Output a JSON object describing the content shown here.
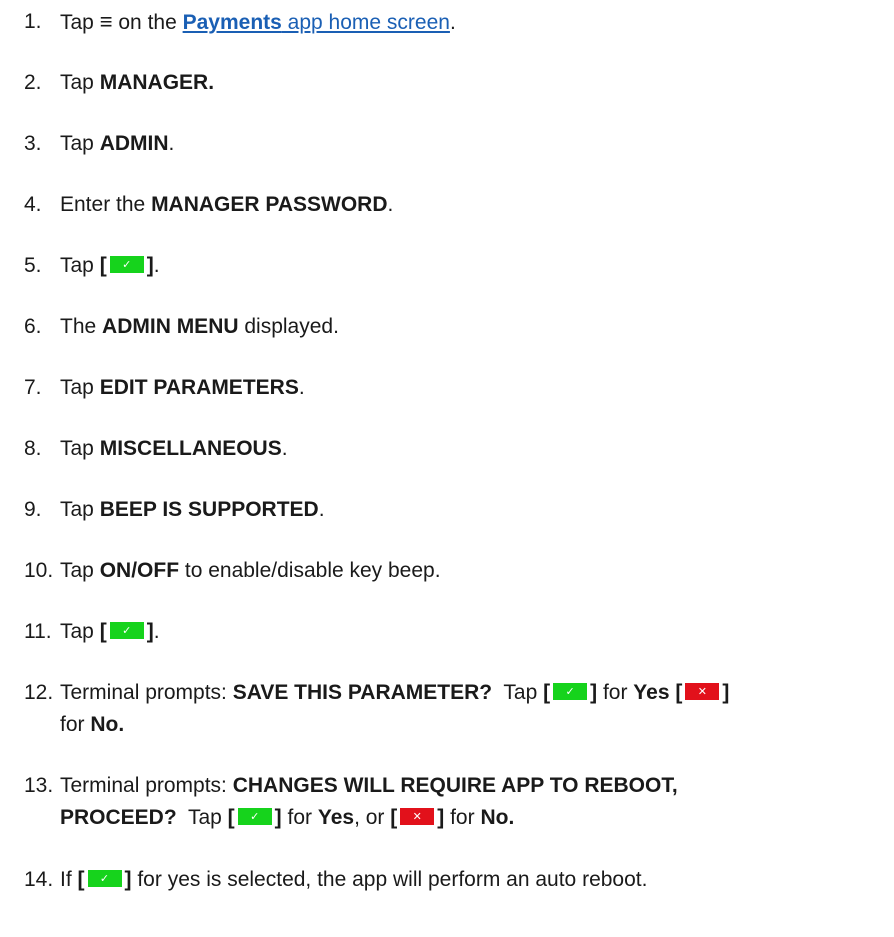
{
  "steps": [
    {
      "num": "1.",
      "parts": {
        "a": "Tap ",
        "icon": "≡",
        "b": " on the ",
        "link_bold": "Payments",
        "link_rest": " app home screen",
        "c": "."
      }
    },
    {
      "num": "2.",
      "parts": {
        "a": "Tap ",
        "b1": "MANAGER."
      }
    },
    {
      "num": "3.",
      "parts": {
        "a": "Tap ",
        "b1": "ADMIN",
        "c": "."
      }
    },
    {
      "num": "4.",
      "parts": {
        "a": "Enter the ",
        "b1": "MANAGER PASSWORD",
        "c": "."
      }
    },
    {
      "num": "5.",
      "parts": {
        "a": "Tap ",
        "open": "[",
        "close": "]",
        "c": "."
      }
    },
    {
      "num": "6.",
      "parts": {
        "a": "The ",
        "b1": "ADMIN MENU",
        "c": " displayed."
      }
    },
    {
      "num": "7.",
      "parts": {
        "a": "Tap ",
        "b1": "EDIT PARAMETERS",
        "c": "."
      }
    },
    {
      "num": "8.",
      "parts": {
        "a": "Tap ",
        "b1": "MISCELLANEOUS",
        "c": "."
      }
    },
    {
      "num": "9.",
      "parts": {
        "a": "Tap ",
        "b1": "BEEP IS SUPPORTED",
        "c": "."
      }
    },
    {
      "num": "10.",
      "parts": {
        "a": "Tap ",
        "b1": "ON/OFF",
        "c": " to enable/disable key beep."
      }
    },
    {
      "num": "11.",
      "parts": {
        "a": "Tap ",
        "open": "[",
        "close": "]",
        "c": "."
      }
    },
    {
      "num": "12.",
      "parts": {
        "a": "Terminal prompts: ",
        "b1": "SAVE THIS PARAMETER?",
        "c": "  Tap ",
        "open1": "[",
        "close1": "]",
        "d": " for ",
        "yes": "Yes",
        "open2": "[",
        "close2": "]",
        "e": "for ",
        "no": "No."
      }
    },
    {
      "num": "13.",
      "parts": {
        "a": "Terminal prompts: ",
        "b1": "CHANGES WILL REQUIRE APP TO REBOOT,",
        "b2": "PROCEED?",
        "c": "  Tap ",
        "open1": "[",
        "close1": "]",
        "d": " for ",
        "yes": "Yes",
        "e": ", or ",
        "open2": "[",
        "close2": "]",
        "f": " for ",
        "no": "No."
      }
    },
    {
      "num": "14.",
      "parts": {
        "a": "If ",
        "open": "[",
        "close": "]",
        "c": " for yes is selected, the app will perform an auto reboot."
      }
    }
  ],
  "icons": {
    "ok": "check-icon",
    "cancel": "x-icon",
    "ok_glyph": "✓",
    "cancel_glyph": "✕",
    "ok_color": "#16d31c",
    "cancel_color": "#e2111b",
    "link_color": "#1a5fb4"
  }
}
